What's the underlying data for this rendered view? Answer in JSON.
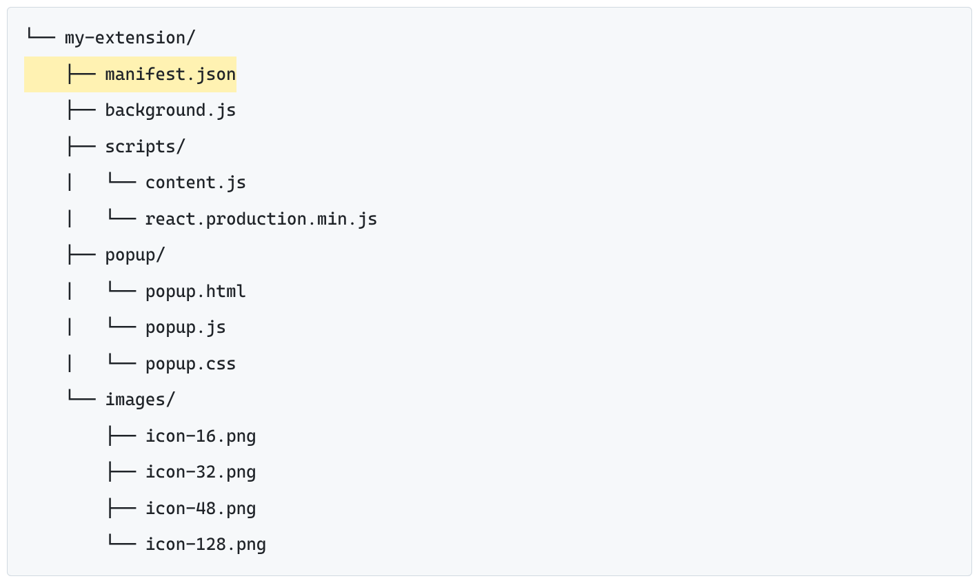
{
  "tree": {
    "lines": [
      {
        "prefix": "└── ",
        "name": "my-extension/",
        "highlighted": false
      },
      {
        "prefix": "    ├── ",
        "name": "manifest.json",
        "highlighted": true
      },
      {
        "prefix": "    ├── ",
        "name": "background.js",
        "highlighted": false
      },
      {
        "prefix": "    ├── ",
        "name": "scripts/",
        "highlighted": false
      },
      {
        "prefix": "    |   └── ",
        "name": "content.js",
        "highlighted": false
      },
      {
        "prefix": "    |   └── ",
        "name": "react.production.min.js",
        "highlighted": false
      },
      {
        "prefix": "    ├── ",
        "name": "popup/",
        "highlighted": false
      },
      {
        "prefix": "    |   └── ",
        "name": "popup.html",
        "highlighted": false
      },
      {
        "prefix": "    |   └── ",
        "name": "popup.js",
        "highlighted": false
      },
      {
        "prefix": "    |   └── ",
        "name": "popup.css",
        "highlighted": false
      },
      {
        "prefix": "    └── ",
        "name": "images/",
        "highlighted": false
      },
      {
        "prefix": "        ├── ",
        "name": "icon-16.png",
        "highlighted": false
      },
      {
        "prefix": "        ├── ",
        "name": "icon-32.png",
        "highlighted": false
      },
      {
        "prefix": "        ├── ",
        "name": "icon-48.png",
        "highlighted": false
      },
      {
        "prefix": "        └── ",
        "name": "icon-128.png",
        "highlighted": false
      }
    ]
  }
}
